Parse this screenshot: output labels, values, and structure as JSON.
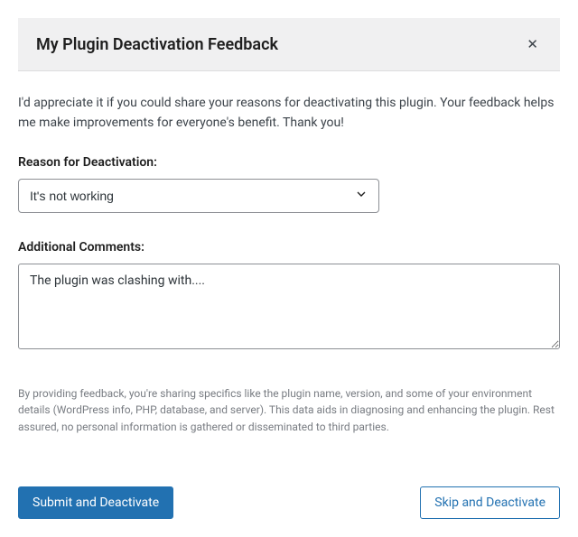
{
  "header": {
    "title": "My Plugin Deactivation Feedback"
  },
  "intro": "I'd appreciate it if you could share your reasons for deactivating this plugin. Your feedback helps me make improvements for everyone's benefit. Thank you!",
  "reason": {
    "label": "Reason for Deactivation:",
    "selected": "It's not working"
  },
  "comments": {
    "label": "Additional Comments:",
    "value": "The plugin was clashing with...."
  },
  "disclaimer": "By providing feedback, you're sharing specifics like the plugin name, version, and some of your environment details (WordPress info, PHP, database, and server). This data aids in diagnosing and enhancing the plugin. Rest assured, no personal information is gathered or disseminated to third parties.",
  "buttons": {
    "submit": "Submit and Deactivate",
    "skip": "Skip and Deactivate"
  }
}
